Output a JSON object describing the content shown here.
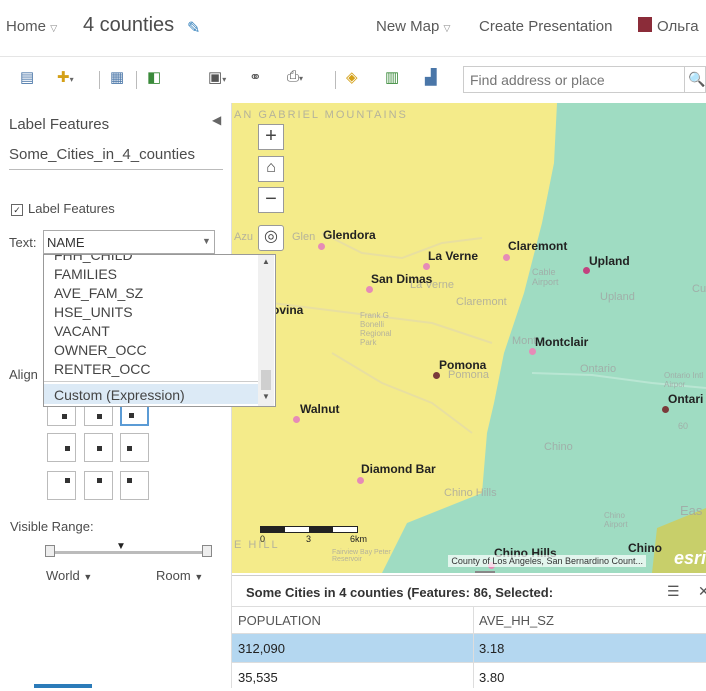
{
  "header": {
    "home": "Home",
    "title": "4 counties",
    "new_map": "New Map",
    "create_presentation": "Create Presentation",
    "username": "Ольга"
  },
  "toolbar": {
    "search_placeholder": "Find address or place",
    "icons": [
      "details-icon",
      "add-icon",
      "basemap-icon",
      "analysis-icon",
      "save-icon",
      "share-icon",
      "print-icon",
      "directions-icon",
      "measure-icon",
      "bookmarks-icon",
      "search-icon"
    ]
  },
  "panel": {
    "title": "Label Features",
    "layer_name": "Some_Cities_in_4_counties",
    "checkbox_label": "Label Features",
    "text_label": "Text:",
    "text_value": "NAME",
    "options": [
      "FHH_CHILD",
      "FAMILIES",
      "AVE_FAM_SZ",
      "HSE_UNITS",
      "VACANT",
      "OWNER_OCC",
      "RENTER_OCC"
    ],
    "custom_option": "Custom (Expression)",
    "align_label": "Align",
    "visible_range_label": "Visible Range:",
    "world": "World",
    "room": "Room"
  },
  "map": {
    "cities": [
      {
        "name": "Glendora",
        "color": "#e68bb7"
      },
      {
        "name": "La Verne",
        "color": "#e68bb7"
      },
      {
        "name": "Claremont",
        "color": "#e68bb7"
      },
      {
        "name": "Upland",
        "color": "#c2427f"
      },
      {
        "name": "San Dimas",
        "color": "#e68bb7"
      },
      {
        "name": "ovina",
        "color": "#e68bb7"
      },
      {
        "name": "Montclair",
        "color": "#e68bb7"
      },
      {
        "name": "Pomona",
        "color": "#7a3a3a"
      },
      {
        "name": "Ontari",
        "color": "#7a3a3a"
      },
      {
        "name": "Walnut",
        "color": "#e68bb7"
      },
      {
        "name": "Diamond Bar",
        "color": "#e68bb7"
      },
      {
        "name": "Chino Hills",
        "color": "#e68bb7"
      },
      {
        "name": "Chino",
        "color": "#e68bb7"
      }
    ],
    "ghost_labels": [
      "AN GABRIEL MOUNTAINS",
      "Glen",
      "Azu",
      "La Verne",
      "Cable Airport",
      "Claremont",
      "Upland",
      "Frank G Bonelli Regional Park",
      "Mont",
      "Pomona",
      "Ontario",
      "Ontario Intl Airpor",
      "Chino",
      "Chino Hills",
      "Chino Airport",
      "Eas",
      "Cu",
      "60",
      "Fairview Bay Peter Reservoir",
      "E HILL"
    ],
    "scale_labels": [
      "0",
      "3",
      "6km"
    ],
    "attribution": "County of Los Angeles, San Bernardino Count...",
    "esri": "esri",
    "colors": {
      "yellow": "#f4eb8a",
      "teal": "#9fdcc2",
      "olive": "#c8cf6a"
    }
  },
  "table": {
    "header": "Some Cities in 4 counties (Features: 86, Selected:",
    "columns": [
      "POPULATION",
      "AVE_HH_SZ"
    ],
    "rows": [
      {
        "population": "312,090",
        "ave_hh_sz": "3.18",
        "selected": true
      },
      {
        "population": "35,535",
        "ave_hh_sz": "3.80",
        "selected": false
      }
    ]
  }
}
